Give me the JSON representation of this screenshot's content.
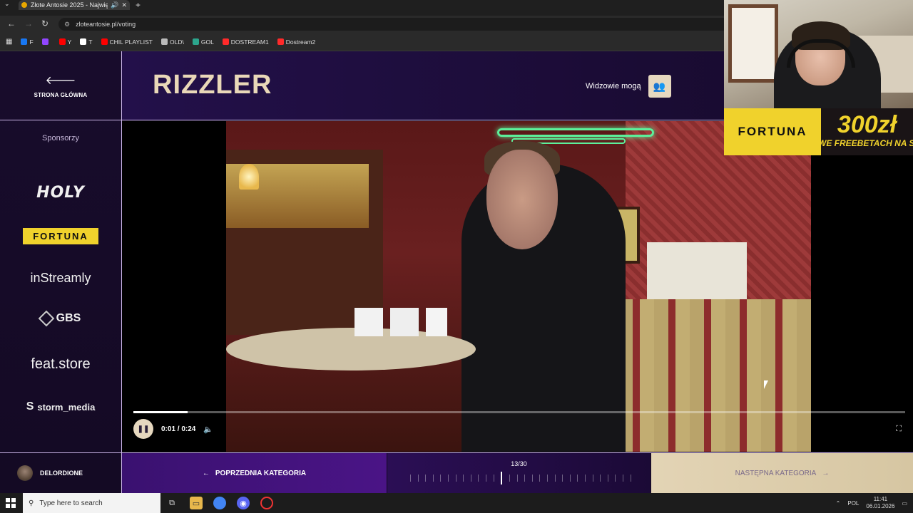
{
  "browser": {
    "tab_title": "Złote Antosie 2025 - Najwię",
    "url": "zloteantosie.pl/voting",
    "bookmarks": [
      {
        "label": "F",
        "color": "#1877f2"
      },
      {
        "label": "",
        "color": "#9146ff"
      },
      {
        "label": "Y",
        "color": "#ff0000"
      },
      {
        "label": "T",
        "color": "#ffffff"
      },
      {
        "label": "CHIL PLAYLIST",
        "color": "#ff0000"
      },
      {
        "label": "OLD\\",
        "color": "#bbbbbb"
      },
      {
        "label": "GOL",
        "color": "#2ca58d"
      },
      {
        "label": "DOSTREAM1",
        "color": "#ff2a2a"
      },
      {
        "label": "Dostream2",
        "color": "#ff2a2a"
      }
    ]
  },
  "sidebar": {
    "home_label": "STRONA GŁÓWNA",
    "sponsors_title": "Sponsorzy",
    "sponsors": [
      "HOLY",
      "FORTUNA",
      "inStreamly",
      "GBS",
      "feat.store",
      "storm_media"
    ],
    "user_name": "DELORDIONE"
  },
  "header": {
    "title": "RIZZLER",
    "viewers_label": "Widzowie mogą"
  },
  "player": {
    "time": "0:01 / 0:24",
    "progress": 0.07
  },
  "footer": {
    "prev_label": "POPRZEDNIA KATEGORIA",
    "counter": "13/30",
    "current": 13,
    "total": 30,
    "next_label": "NASTĘPNA KATEGORIA"
  },
  "overlay": {
    "ad_brand": "FORTUNA",
    "ad_amount": "300zł",
    "ad_sub": "WE FREEBETACH NA STAR"
  },
  "taskbar": {
    "search_placeholder": "Type here to search",
    "language": "POL",
    "time": "11:41",
    "date": "06.01.2026"
  },
  "colors": {
    "accent_gold": "#e9d8b8",
    "purple": "#3a1170",
    "fortuna_yellow": "#f0d22c"
  }
}
